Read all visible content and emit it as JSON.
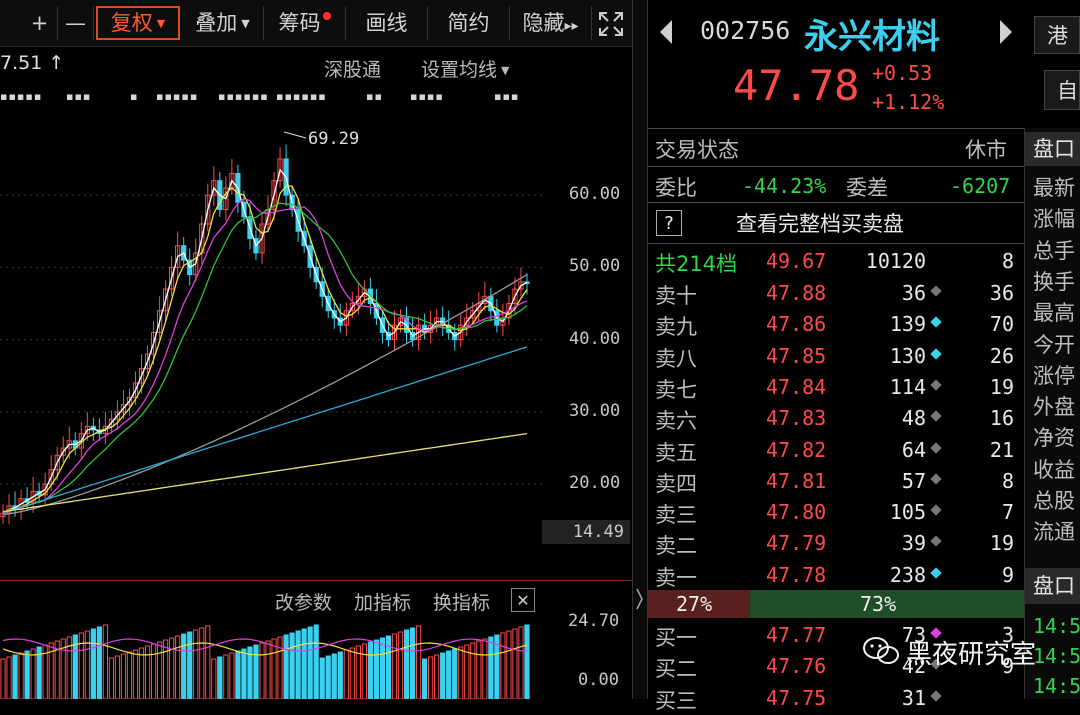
{
  "toolbar": {
    "plus": "+",
    "minus": "—",
    "fuquan": "复权",
    "diejia": "叠加",
    "chouma": "筹码",
    "huaxian": "画线",
    "jianyue": "简约",
    "yincang": "隐藏",
    "yincang_arrows": "▸▸"
  },
  "chart_header": {
    "value_left": "7.51",
    "shengutong": "深股通",
    "settings": "设置均线"
  },
  "marks_row": [
    "▪▪▪▪▪",
    "▪▪▪",
    "▪",
    "▪▪▪▪▪",
    "▪▪▪▪▪▪",
    "▪▪▪▪▪▪",
    "▪▪",
    "▪▪▪▪",
    "▪▪▪"
  ],
  "chart_data": {
    "type": "candlestick",
    "price_axis_ticks": [
      "60.00",
      "50.00",
      "40.00",
      "30.00",
      "20.00"
    ],
    "tick_values": [
      60,
      50,
      40,
      30,
      20
    ],
    "ylim": [
      14.49,
      69.29
    ],
    "max_label": "69.29",
    "max_value": 69.29,
    "current_low_label": "14.49",
    "closes": [
      16,
      17,
      16.5,
      18,
      17.5,
      19,
      18.5,
      20,
      22,
      24,
      25,
      26,
      25,
      27,
      28,
      27.5,
      27,
      28,
      29,
      30,
      31,
      32,
      34,
      36,
      38,
      41,
      44,
      47,
      50,
      53,
      51,
      49,
      52,
      56,
      60,
      62,
      58,
      61,
      63,
      59,
      57,
      54,
      52,
      56,
      58,
      62,
      65,
      60,
      58,
      55,
      53,
      50,
      48,
      46,
      44,
      43,
      42,
      44,
      45,
      46,
      47,
      45,
      43,
      41,
      40,
      42,
      43,
      41,
      40,
      42,
      41,
      42,
      43,
      42,
      41,
      40,
      42,
      43,
      44,
      45,
      46,
      44,
      42,
      43,
      45,
      47,
      48,
      47.78
    ],
    "ma_lines": [
      {
        "color": "#ffffff",
        "period": 5
      },
      {
        "color": "#f2e23a",
        "period": 10
      },
      {
        "color": "#e040e0",
        "period": 20
      },
      {
        "color": "#30c040",
        "period": 30
      },
      {
        "color": "#9a9a9a",
        "period": 60
      },
      {
        "color": "#2aa8d8",
        "period": 120
      },
      {
        "color": "#e8e070",
        "period": 250
      }
    ]
  },
  "indicator_bar": {
    "gaicanshu": "改参数",
    "jiazhibiao": "加指标",
    "huanzhibiao": "换指标",
    "close": "✕"
  },
  "volume_data": {
    "ticks": [
      "24.70",
      "0.00"
    ],
    "ymax": 24.7
  },
  "stock": {
    "code": "002756",
    "name": "永兴材料",
    "price": "47.78",
    "change": "+0.53",
    "change_pct": "+1.12%",
    "gang": "港",
    "zi": "自"
  },
  "status": {
    "label": "交易状态",
    "value": "休市"
  },
  "weibi": {
    "label1": "委比",
    "value1": "-44.23%",
    "label2": "委差",
    "value2": "-6207"
  },
  "view_full": "查看完整档买卖盘",
  "total_row": {
    "label": "共214档",
    "price": "49.67",
    "volume": "10120",
    "count": "8"
  },
  "sell_orders": [
    {
      "label": "卖十",
      "price": "47.88",
      "volume": "36",
      "count": "36",
      "dot": "gray"
    },
    {
      "label": "卖九",
      "price": "47.86",
      "volume": "139",
      "count": "70",
      "dot": "cyan"
    },
    {
      "label": "卖八",
      "price": "47.85",
      "volume": "130",
      "count": "26",
      "dot": "cyan"
    },
    {
      "label": "卖七",
      "price": "47.84",
      "volume": "114",
      "count": "19",
      "dot": "gray"
    },
    {
      "label": "卖六",
      "price": "47.83",
      "volume": "48",
      "count": "16",
      "dot": "gray"
    },
    {
      "label": "卖五",
      "price": "47.82",
      "volume": "64",
      "count": "21",
      "dot": "gray"
    },
    {
      "label": "卖四",
      "price": "47.81",
      "volume": "57",
      "count": "8",
      "dot": "gray"
    },
    {
      "label": "卖三",
      "price": "47.80",
      "volume": "105",
      "count": "7",
      "dot": "gray"
    },
    {
      "label": "卖二",
      "price": "47.79",
      "volume": "39",
      "count": "19",
      "dot": "gray"
    },
    {
      "label": "卖一",
      "price": "47.78",
      "volume": "238",
      "count": "9",
      "dot": "cyan"
    }
  ],
  "ratio": {
    "buy": "27%",
    "sell": "73%",
    "buy_fraction": 0.27
  },
  "buy_orders": [
    {
      "label": "买一",
      "price": "47.77",
      "volume": "73",
      "count": "3",
      "dot": "magenta"
    },
    {
      "label": "买二",
      "price": "47.76",
      "volume": "42",
      "count": "9",
      "dot": "gray"
    },
    {
      "label": "买三",
      "price": "47.75",
      "volume": "31",
      "count": "",
      "dot": "gray"
    }
  ],
  "side_panel": {
    "header": "盘口",
    "items": [
      "最新",
      "涨幅",
      "总手",
      "换手",
      "最高",
      "今开",
      "涨停",
      "外盘",
      "净资",
      "收益",
      "总股",
      "流通"
    ],
    "header2": "盘口",
    "times": [
      "14:5",
      "14:5",
      "14:5"
    ]
  },
  "watermark": "黑夜研究室"
}
